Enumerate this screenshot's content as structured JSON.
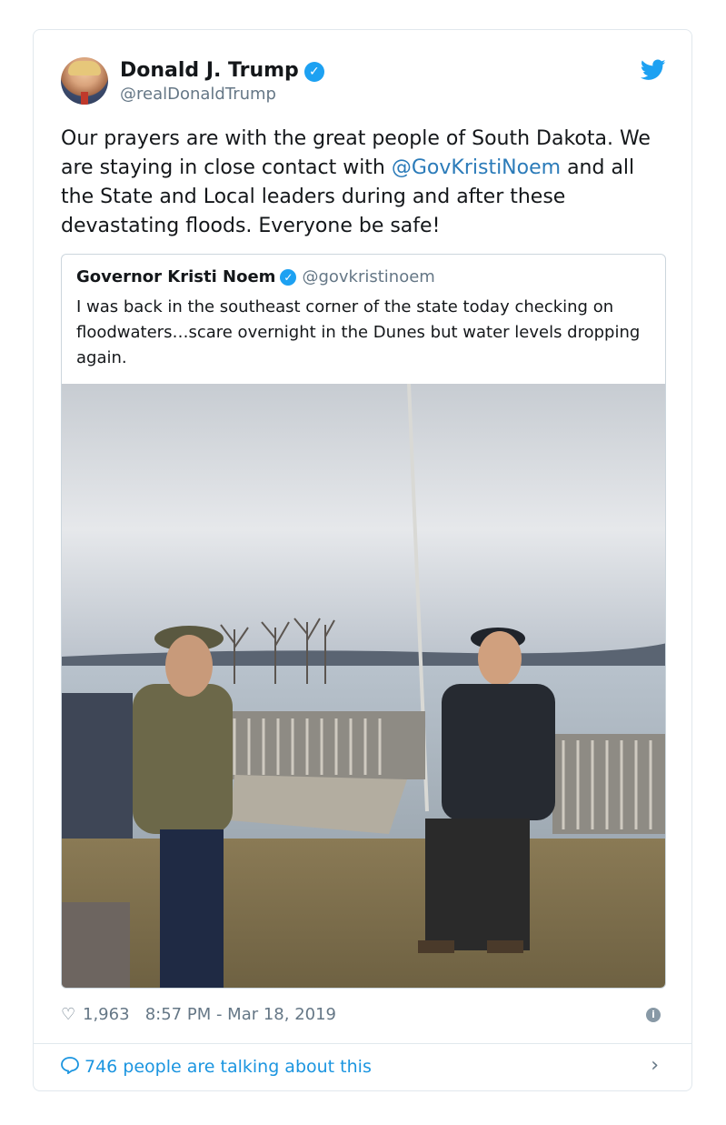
{
  "author": {
    "name": "Donald J. Trump",
    "handle": "@realDonaldTrump",
    "verified_icon": "verified-badge-icon",
    "avatar_icon": "avatar"
  },
  "tweet": {
    "text_before": "Our prayers are with the great people of South Dakota. We are staying in close contact with ",
    "mention": "@GovKristiNoem",
    "text_after": " and all the State and Local leaders during and after these devastating floods. Everyone be safe!"
  },
  "quoted": {
    "name": "Governor Kristi Noem",
    "handle": "@govkristinoem",
    "text": "I was back in the southeast corner of the state today checking on floodwaters…scare overnight in the Dunes but water levels dropping again."
  },
  "stats": {
    "likes": "1,963",
    "timestamp": "8:57 PM - Mar 18, 2019"
  },
  "footer": {
    "talking": "746 people are talking about this"
  },
  "colors": {
    "accent": "#1da1f2",
    "link": "#2b7bb9",
    "muted": "#657786"
  }
}
